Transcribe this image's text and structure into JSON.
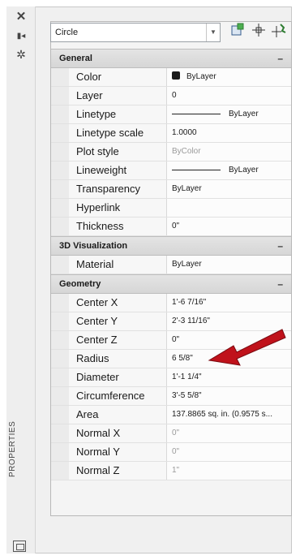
{
  "sidebar": {
    "label": "PROPERTIES",
    "icons": [
      "close-icon",
      "pin-icon",
      "settings-icon",
      "panel-icon"
    ]
  },
  "toolbar": {
    "selected_object": "Circle",
    "icons": [
      "select-objects-icon",
      "pick-add-icon",
      "quick-select-icon"
    ]
  },
  "sections": [
    {
      "title": "General",
      "collapse": "–",
      "rows": [
        {
          "name": "Color",
          "value": "ByLayer",
          "kind": "swatch"
        },
        {
          "name": "Layer",
          "value": "0"
        },
        {
          "name": "Linetype",
          "value": "ByLayer",
          "kind": "line"
        },
        {
          "name": "Linetype scale",
          "value": "1.0000"
        },
        {
          "name": "Plot style",
          "value": "ByColor",
          "muted": true
        },
        {
          "name": "Lineweight",
          "value": "ByLayer",
          "kind": "line"
        },
        {
          "name": "Transparency",
          "value": "ByLayer"
        },
        {
          "name": "Hyperlink",
          "value": ""
        },
        {
          "name": "Thickness",
          "value": "0\""
        }
      ]
    },
    {
      "title": "3D Visualization",
      "collapse": "–",
      "rows": [
        {
          "name": "Material",
          "value": "ByLayer"
        }
      ]
    },
    {
      "title": "Geometry",
      "collapse": "–",
      "rows": [
        {
          "name": "Center X",
          "value": "1'-6 7/16\""
        },
        {
          "name": "Center Y",
          "value": "2'-3 11/16\""
        },
        {
          "name": "Center Z",
          "value": "0\""
        },
        {
          "name": "Radius",
          "value": "6 5/8\""
        },
        {
          "name": "Diameter",
          "value": "1'-1 1/4\""
        },
        {
          "name": "Circumference",
          "value": "3'-5 5/8\""
        },
        {
          "name": "Area",
          "value": "137.8865 sq. in. (0.9575 s..."
        },
        {
          "name": "Normal X",
          "value": "0\"",
          "muted": true
        },
        {
          "name": "Normal Y",
          "value": "0\"",
          "muted": true
        },
        {
          "name": "Normal Z",
          "value": "1\"",
          "muted": true
        }
      ]
    }
  ],
  "annotation": {
    "color": "#c0121b",
    "points_to": "Radius"
  }
}
